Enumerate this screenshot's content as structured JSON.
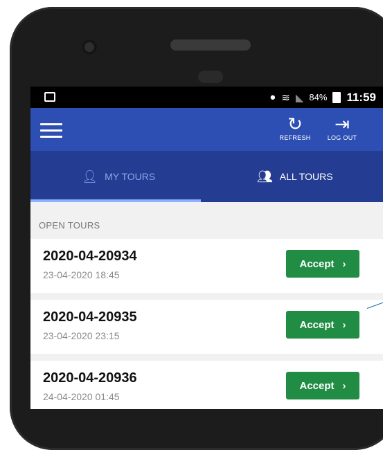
{
  "status_bar": {
    "battery": "84%",
    "time": "11:59"
  },
  "app_bar": {
    "refresh_label": "REFRESH",
    "logout_label": "LOG OUT"
  },
  "tabs": [
    {
      "label": "MY TOURS",
      "active": true,
      "icon": "person-icon"
    },
    {
      "label": "ALL TOURS",
      "active": false,
      "icon": "people-icon"
    }
  ],
  "section_label": "OPEN TOURS",
  "tours": [
    {
      "id": "2020-04-20934",
      "date": "23-04-2020 18:45",
      "action": "Accept"
    },
    {
      "id": "2020-04-20935",
      "date": "23-04-2020 23:15",
      "action": "Accept"
    },
    {
      "id": "2020-04-20936",
      "date": "24-04-2020 01:45",
      "action": "Accept"
    }
  ],
  "colors": {
    "app_bar": "#2d4fb3",
    "tab_bar": "#243c92",
    "accept_button": "#218c44"
  }
}
